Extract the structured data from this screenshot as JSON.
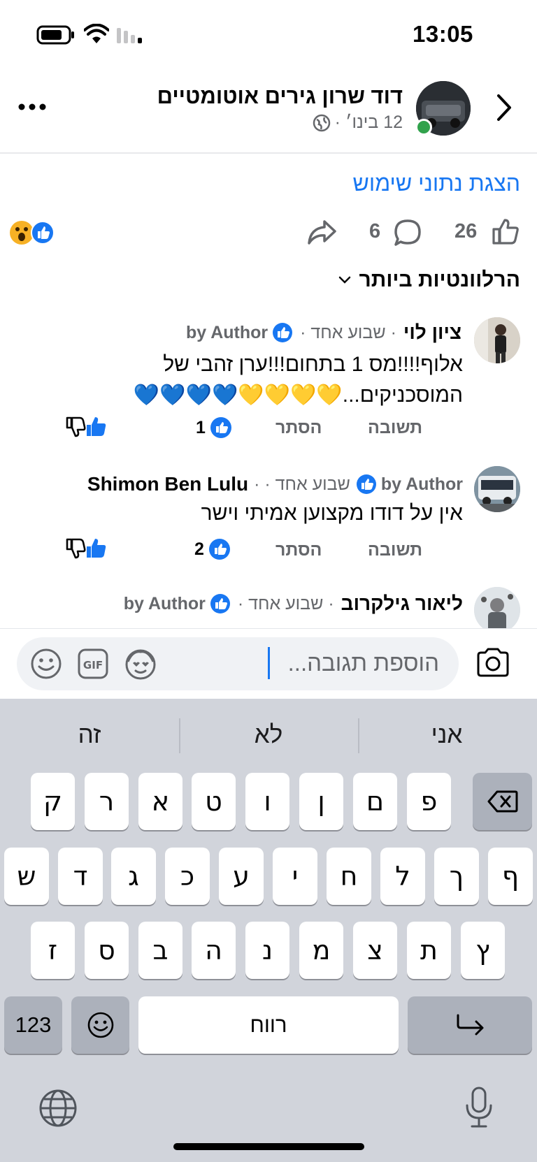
{
  "status_bar": {
    "time": "13:05"
  },
  "header": {
    "title": "דוד שרון גירים אוטומטיים",
    "subtitle": "12 בינו׳ ·",
    "back_icon": "chevron-right-icon",
    "more_icon": "more-dots-icon"
  },
  "post": {
    "usage_link": "הצגת נתוני שימוש",
    "likes_count": "26",
    "comments_count": "6",
    "reactions": [
      "like",
      "wow"
    ]
  },
  "comments_section": {
    "sort_label": "הרלוונטיות ביותר",
    "comments": [
      {
        "name": "ציון לוי",
        "meta": "· שבוע אחד ·",
        "author_badge": "by Author",
        "text": "אלוף!!!!מס 1 בתחום!!!ערן זהבי של המוסכניקים...💛💛💛💛💙💙💙💙",
        "reply": "תשובה",
        "hide": "הסתר",
        "like_count": "1"
      },
      {
        "name": "Shimon Ben Lulu",
        "meta": "שבוע אחד · ·",
        "author_badge": "by Author",
        "text": "אין על דודו מקצוען אמיתי וישר",
        "reply": "תשובה",
        "hide": "הסתר",
        "like_count": "2"
      },
      {
        "name": "ליאור גילקרוב",
        "meta": "· שבוע אחד ·",
        "author_badge": "by Author"
      }
    ]
  },
  "composer": {
    "placeholder": "הוספת תגובה..."
  },
  "keyboard": {
    "suggestions": [
      "אני",
      "לא",
      "זה"
    ],
    "row1": [
      "ק",
      "ר",
      "א",
      "ט",
      "ו",
      "ן",
      "ם",
      "פ"
    ],
    "row2": [
      "ש",
      "ד",
      "ג",
      "כ",
      "ע",
      "י",
      "ח",
      "ל",
      "ך",
      "ף"
    ],
    "row3": [
      "ז",
      "ס",
      "ב",
      "ה",
      "נ",
      "מ",
      "צ",
      "ת",
      "ץ"
    ],
    "numbers_key": "123",
    "space_key": "רווח"
  }
}
